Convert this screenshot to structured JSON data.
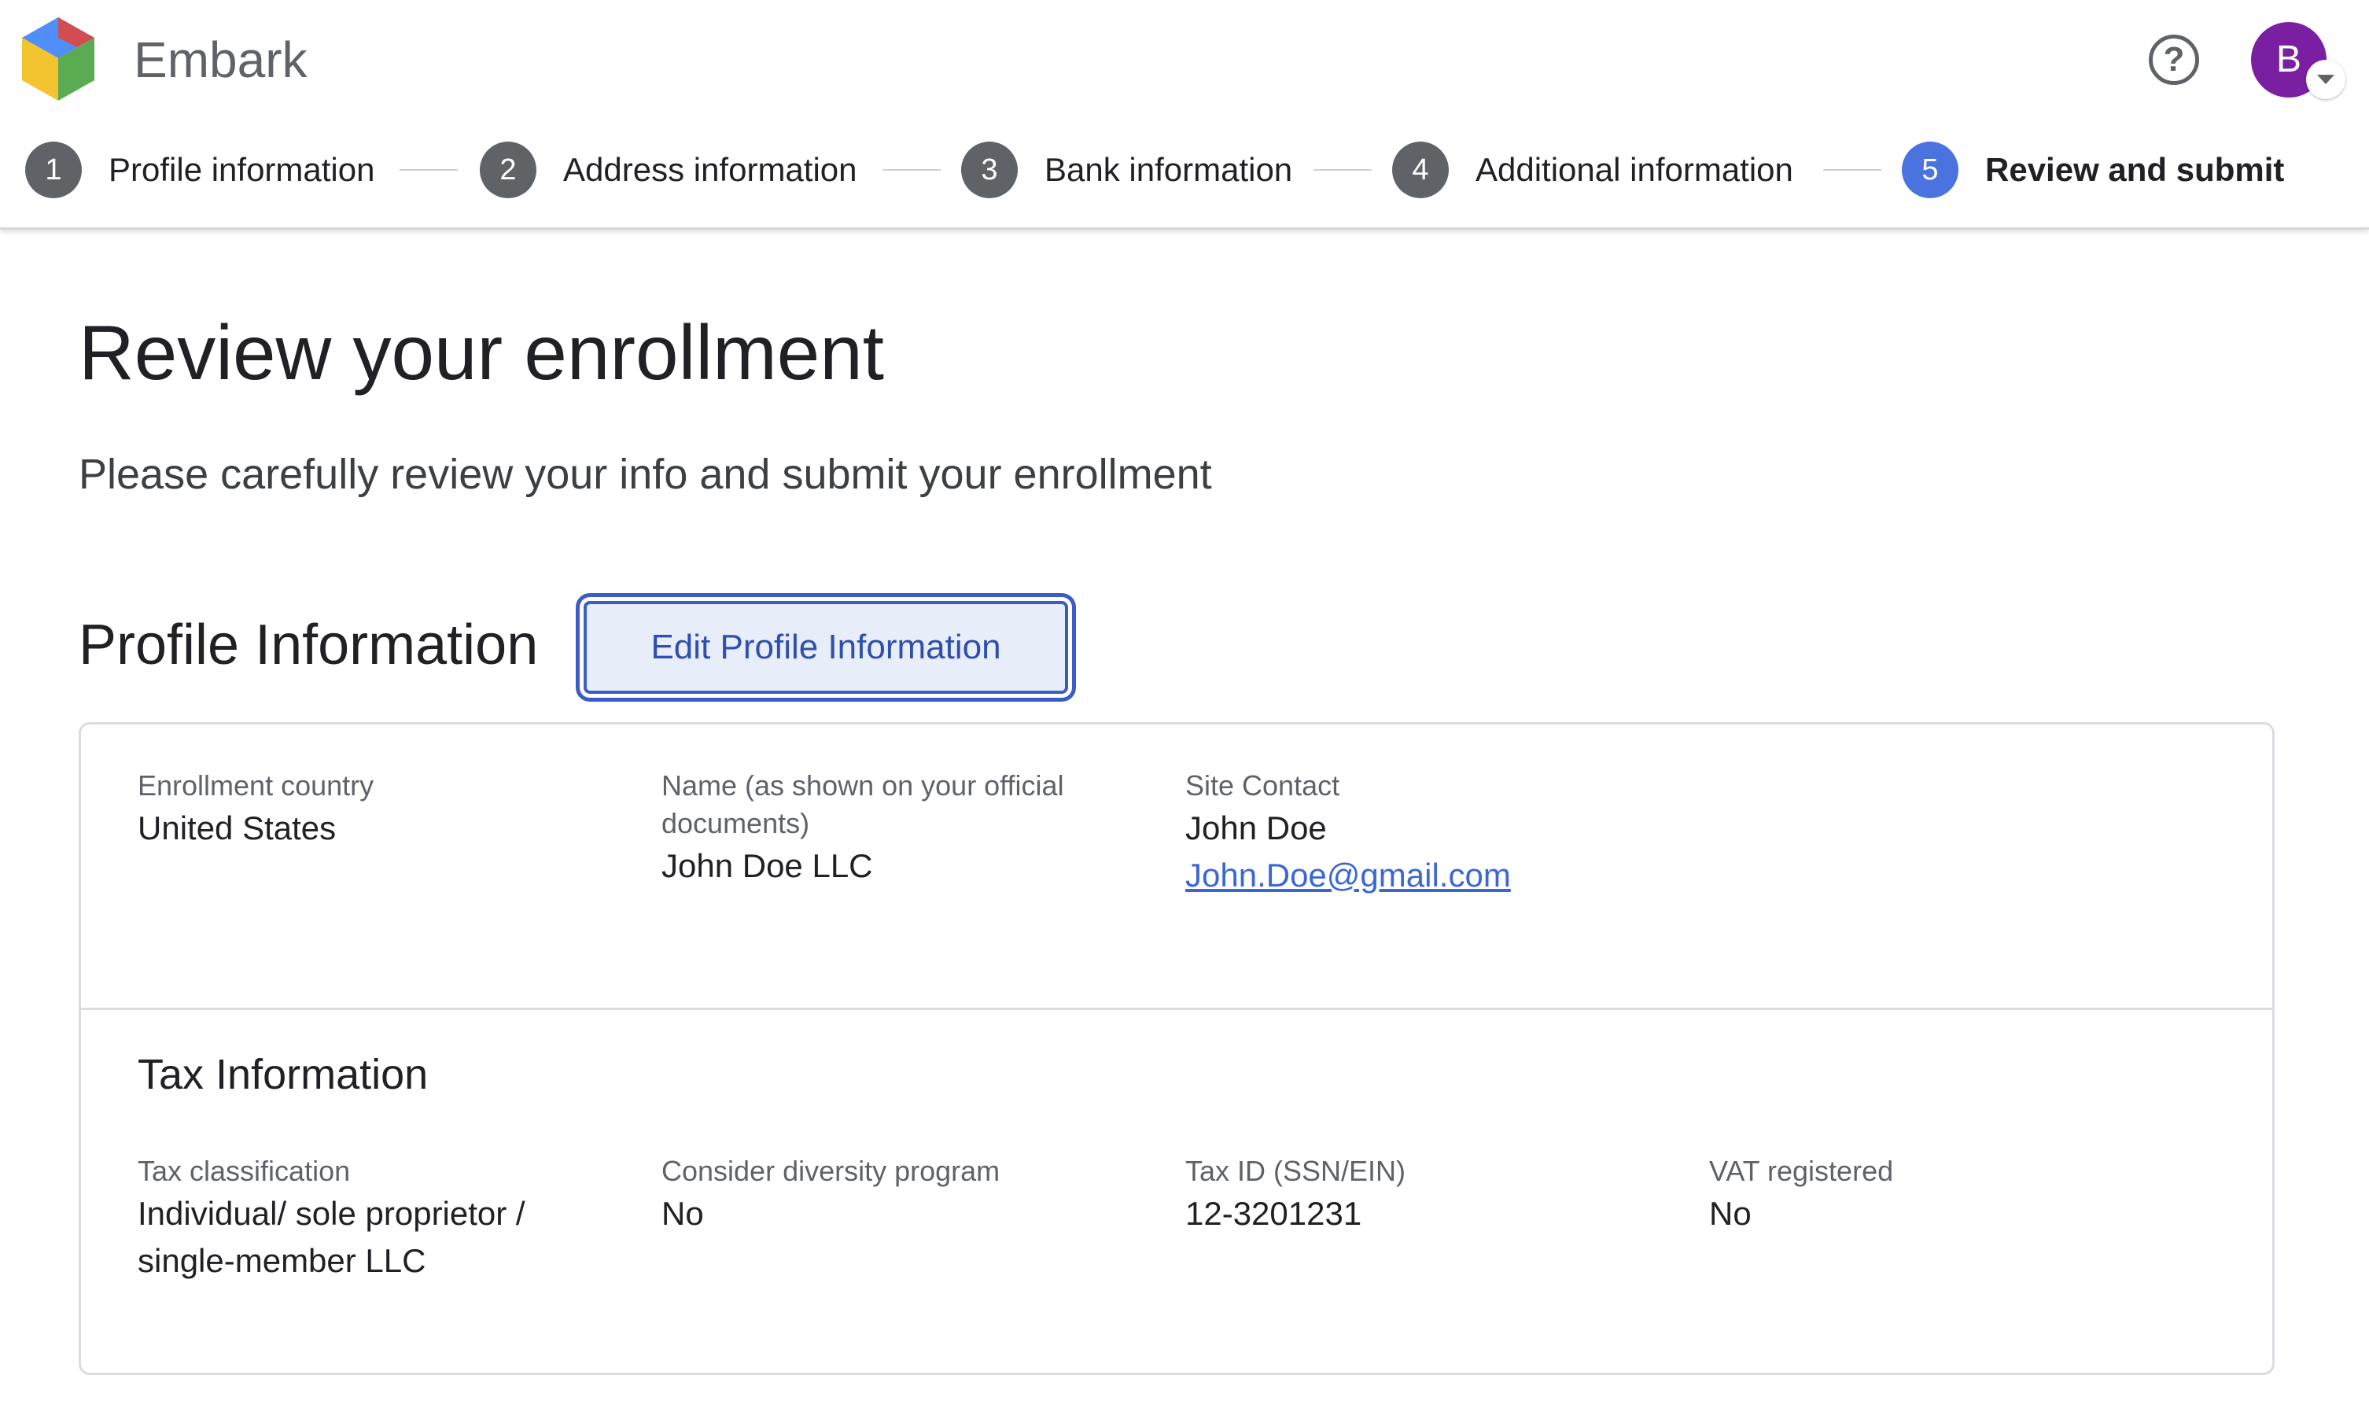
{
  "app": {
    "name": "Embark",
    "user_initial": "B"
  },
  "icons": {
    "logo": "embark-cube-logo",
    "help": "help-circle-icon",
    "avatar_menu": "chevron-down-icon"
  },
  "colors": {
    "active_step": "#4a73e0",
    "inactive_step": "#5f6368",
    "avatar": "#7b1fa2",
    "accent": "#3b5cc4",
    "link": "#3b67d4"
  },
  "stepper": {
    "steps": [
      {
        "number": "1",
        "label": "Profile information"
      },
      {
        "number": "2",
        "label": "Address information"
      },
      {
        "number": "3",
        "label": "Bank information"
      },
      {
        "number": "4",
        "label": "Additional information"
      },
      {
        "number": "5",
        "label": "Review and submit"
      }
    ],
    "active_index": 4
  },
  "page": {
    "title": "Review your enrollment",
    "subtitle": "Please carefully review your info and submit your enrollment"
  },
  "profile_section": {
    "title": "Profile Information",
    "edit_button": "Edit Profile Information",
    "fields": {
      "enrollment_country": {
        "label": "Enrollment country",
        "value": "United States"
      },
      "name": {
        "label": "Name (as shown on your official documents)",
        "value": "John Doe LLC"
      },
      "site_contact": {
        "label": "Site Contact",
        "value": "John Doe",
        "email": "John.Doe@gmail.com"
      }
    }
  },
  "tax_section": {
    "title": "Tax Information",
    "fields": {
      "classification": {
        "label": "Tax classification",
        "value": "Individual/ sole proprietor / single-member LLC"
      },
      "diversity": {
        "label": "Consider diversity program",
        "value": "No"
      },
      "tax_id": {
        "label": "Tax ID (SSN/EIN)",
        "value": "12-3201231"
      },
      "vat": {
        "label": "VAT registered",
        "value": "No"
      }
    }
  }
}
